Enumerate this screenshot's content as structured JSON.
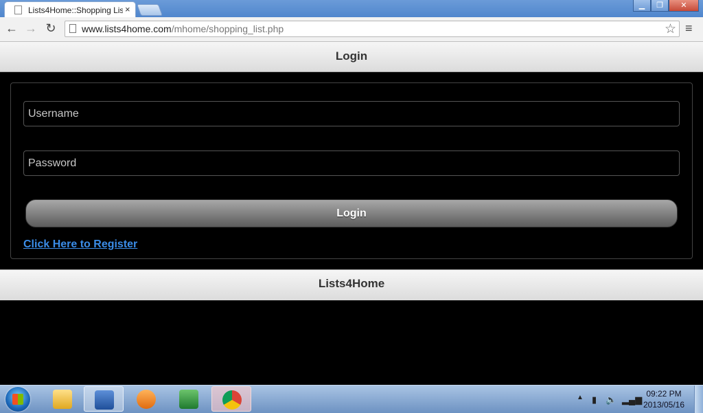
{
  "browser": {
    "tab_title": "Lists4Home::Shopping Lis",
    "tab_close": "×",
    "url_host": "www.lists4home.com",
    "url_path": "/mhome/shopping_list.php",
    "back_icon": "back-arrow-icon",
    "forward_icon": "forward-arrow-icon",
    "reload_icon": "reload-icon",
    "star_icon": "star-icon",
    "menu_icon": "menu-icon"
  },
  "page": {
    "header_title": "Login",
    "footer_title": "Lists4Home",
    "username_placeholder": "Username",
    "password_placeholder": "Password",
    "login_button": "Login",
    "register_link": "Click Here to Register"
  },
  "taskbar": {
    "apps": [
      "windows-explorer",
      "microsoft-word",
      "media-player",
      "microsoft-excel",
      "google-chrome"
    ],
    "clock_time": "09:22 PM",
    "clock_date": "2013/05/16"
  },
  "colors": {
    "link": "#3b8de8",
    "page_background": "#000000"
  }
}
